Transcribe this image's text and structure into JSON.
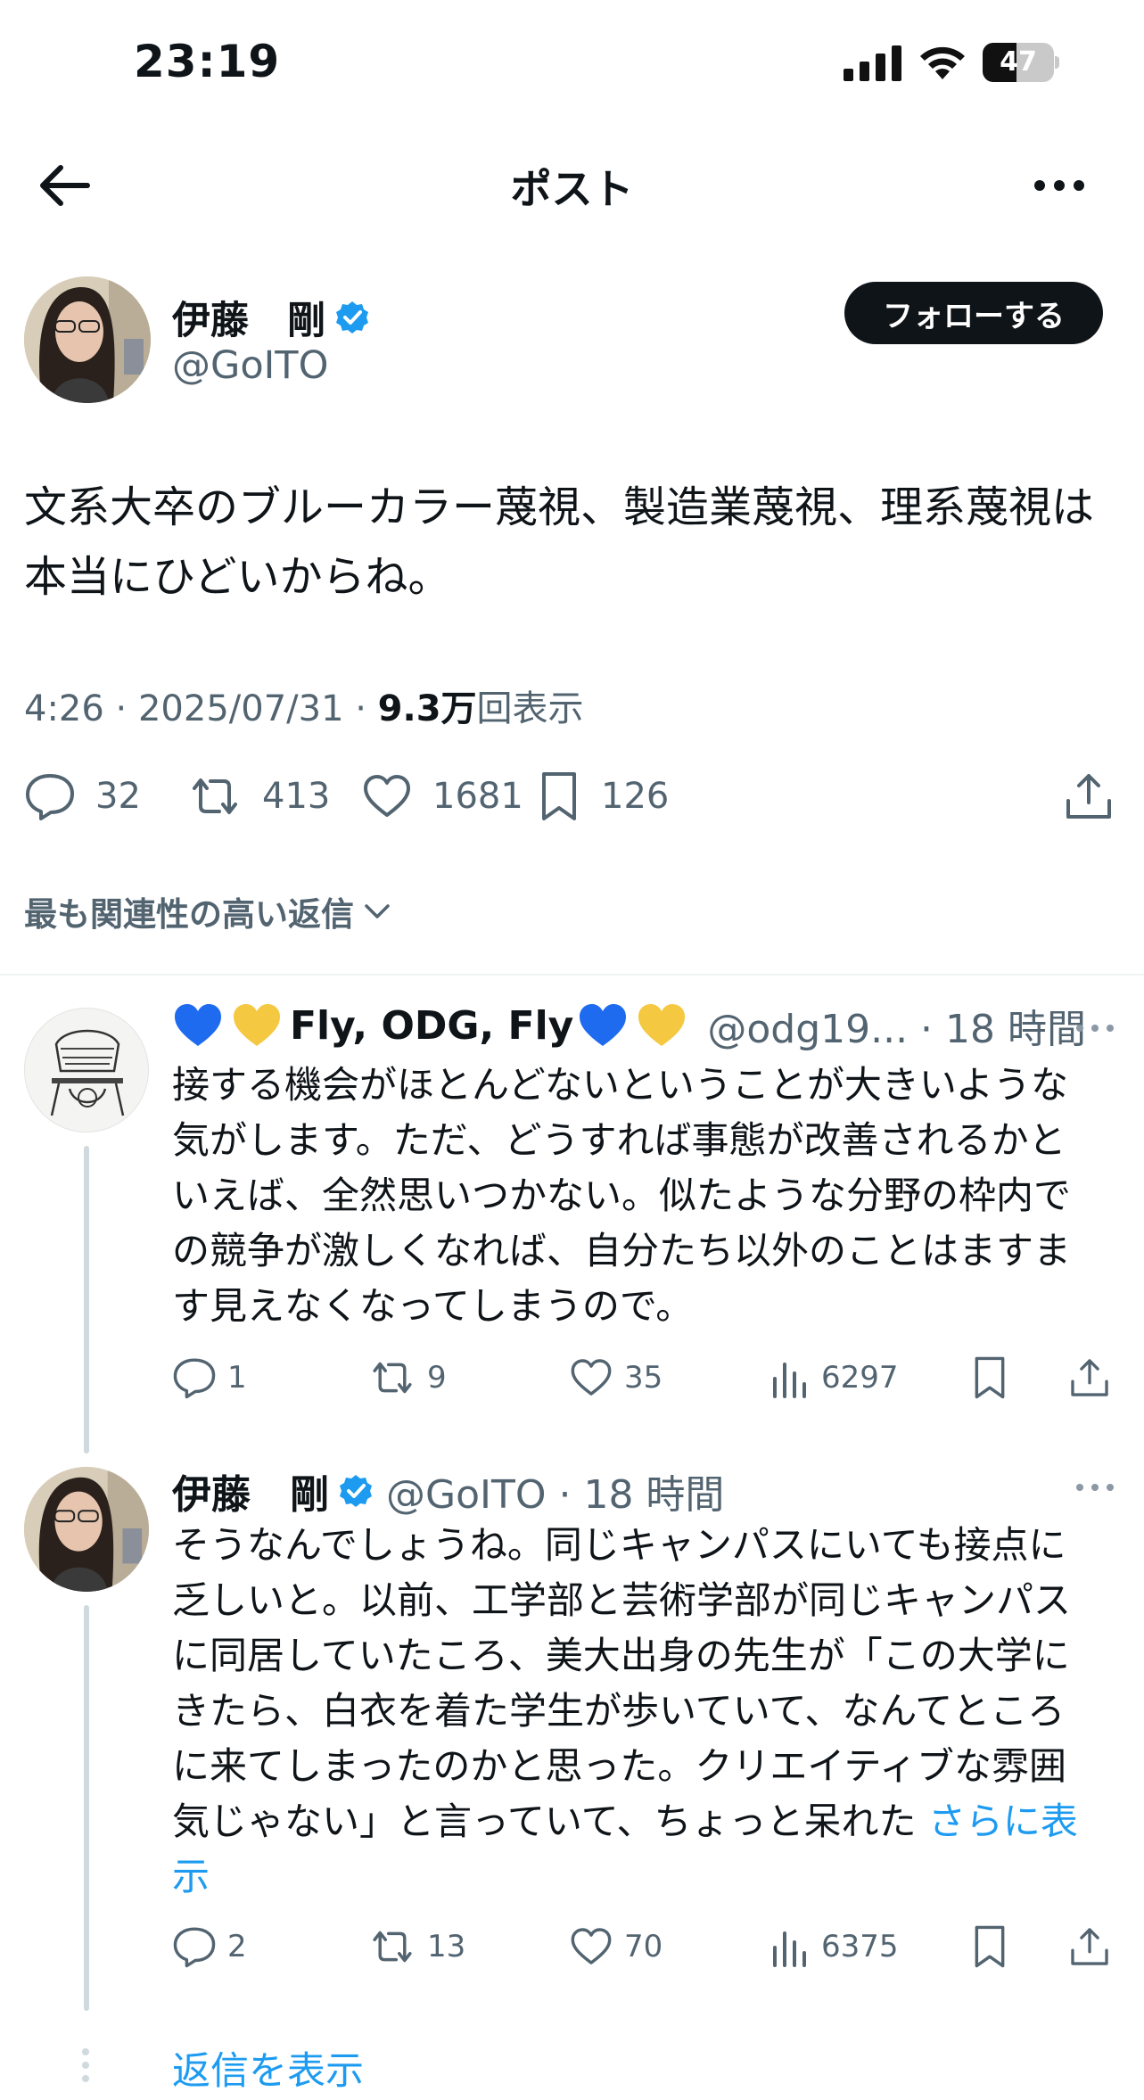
{
  "status": {
    "time": "23:19",
    "battery": "47",
    "battery_level": 0.47
  },
  "nav": {
    "title": "ポスト"
  },
  "post": {
    "author_name": "伊藤　剛",
    "author_handle": "@GoITO",
    "follow_label": "フォローする",
    "text": "文系大卒のブルーカラー蔑視、製造業蔑視、理系蔑視は本当にひどいからね。",
    "meta_time": "4:26 · 2025/07/31 · ",
    "meta_views_value": "9.3万",
    "meta_views_label": "回表示",
    "replies": "32",
    "reposts": "413",
    "likes": "1681",
    "bookmarks": "126"
  },
  "replies_sort_label": "最も関連性の高い返信",
  "reply1": {
    "name": "Fly, ODG, Fly",
    "handle_time": "@odg19... · 18 時間",
    "text": "接する機会がほとんどないということが大きいような気がします。ただ、どうすれば事態が改善されるかといえば、全然思いつかない。似たような分野の枠内での競争が激しくなれば、自分たち以外のことはますます見えなくなってしまうので。",
    "replies": "1",
    "reposts": "9",
    "likes": "35",
    "views": "6297"
  },
  "reply2": {
    "name": "伊藤　剛",
    "handle_time": "@GoITO · 18 時間",
    "text": "そうなんでしょうね。同じキャンパスにいても接点に乏しいと。以前、工学部と芸術学部が同じキャンパスに同居していたころ、美大出身の先生が「この大学にきたら、白衣を着た学生が歩いていて、なんてところに来てしまったのかと思った。クリエイティブな雰囲気じゃない」と言っていて、ちょっと呆れた ",
    "more_label": "さらに表示",
    "replies": "2",
    "reposts": "13",
    "likes": "70",
    "views": "6375"
  },
  "show_replies_label": "返信を表示",
  "colors": {
    "accent": "#1d9bf0",
    "text": "#0f1419",
    "muted": "#536471",
    "verified": "#1d9bf0"
  }
}
